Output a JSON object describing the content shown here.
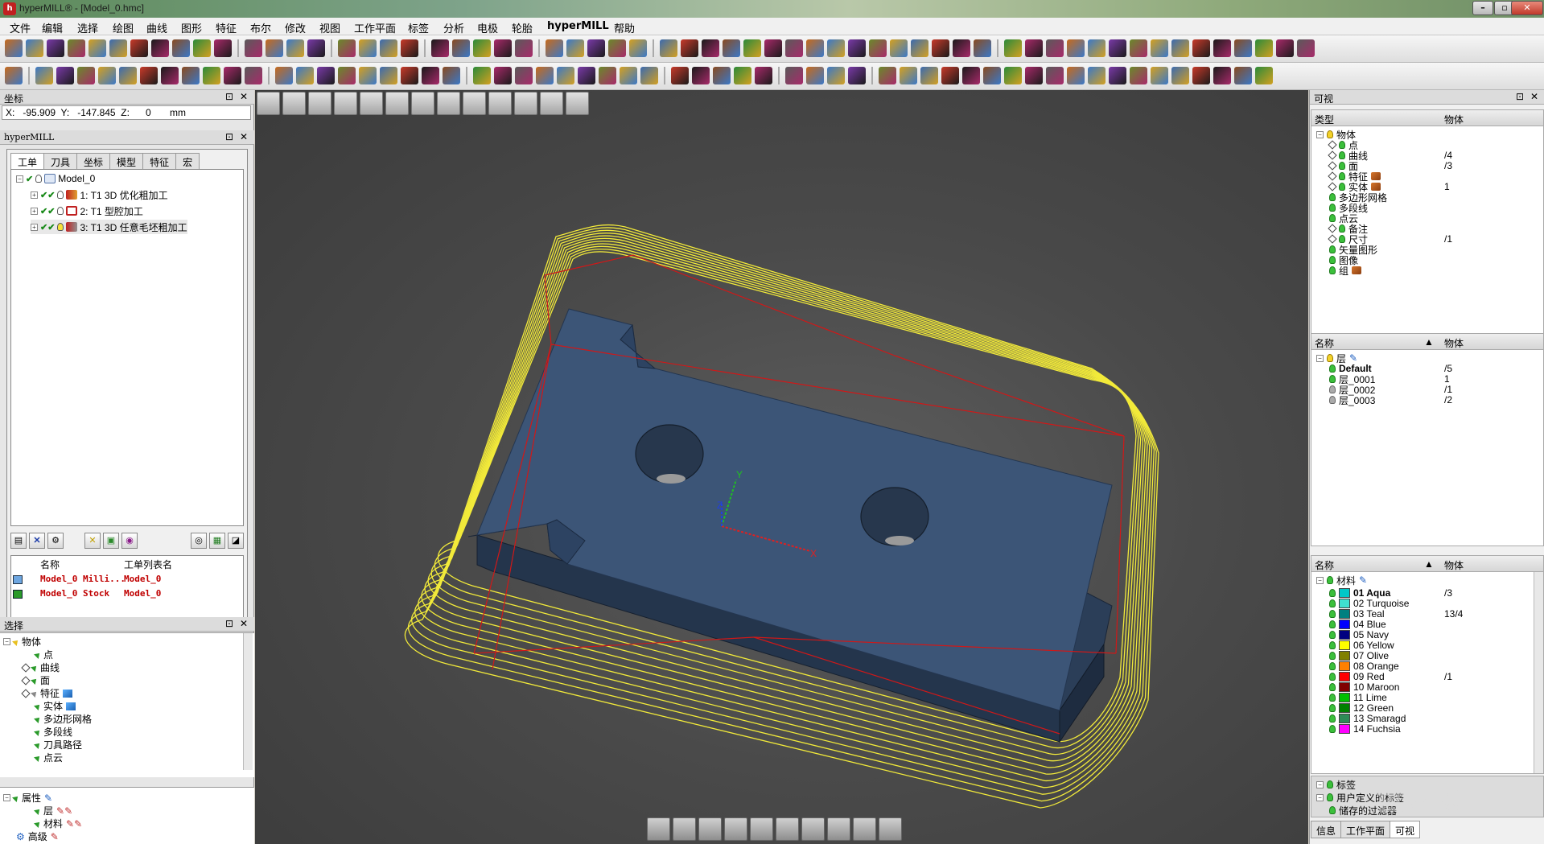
{
  "window": {
    "title": "hyperMILL® - [Model_0.hmc]",
    "app_icon": "h",
    "min_label": "–",
    "max_label": "▫",
    "close_label": "✕"
  },
  "menu": [
    "文件",
    "编辑",
    "选择",
    "绘图",
    "曲线",
    "图形",
    "特征",
    "布尔",
    "修改",
    "视图",
    "工作平面",
    "标签",
    "分析",
    "电极",
    "轮胎",
    "hyperMILL",
    "帮助"
  ],
  "left": {
    "coord_panel_title": "坐标",
    "coord_readout": {
      "x_label": "X:",
      "x": "-95.909",
      "y_label": "Y:",
      "y": "-147.845",
      "z_label": "Z:",
      "z": "0",
      "unit": "mm"
    },
    "hypermill_panel_title": "hyperMILL",
    "tabs": [
      "工单",
      "刀具",
      "坐标",
      "模型",
      "特征",
      "宏"
    ],
    "tree": {
      "root": "Model_0",
      "jobs": [
        "1: T1 3D 优化粗加工",
        "2: T1 型腔加工",
        "3: T1 3D 任意毛坯粗加工"
      ]
    },
    "ref_table": {
      "headers": [
        "名称",
        "工单列表名"
      ],
      "rows": [
        {
          "name": "Model_0 Milli...",
          "list": "Model_0"
        },
        {
          "name": "Model_0 Stock",
          "list": "Model_0"
        }
      ]
    },
    "select_panel_title": "选择",
    "select_tree": [
      "物体",
      "点",
      "曲线",
      "面",
      "特征",
      "实体",
      "多边形网格",
      "多段线",
      "刀具路径",
      "点云"
    ],
    "attr_tree": [
      "属性",
      "层",
      "材料",
      "高级"
    ]
  },
  "right": {
    "panel_title": "可视",
    "objects_header": {
      "type": "类型",
      "count": "物体"
    },
    "objects": [
      {
        "label": "物体",
        "count": ""
      },
      {
        "label": "点",
        "count": ""
      },
      {
        "label": "曲线",
        "count": "/4"
      },
      {
        "label": "面",
        "count": "/3"
      },
      {
        "label": "特征",
        "count": ""
      },
      {
        "label": "实体",
        "count": "1"
      },
      {
        "label": "多边形网格",
        "count": ""
      },
      {
        "label": "多段线",
        "count": ""
      },
      {
        "label": "点云",
        "count": ""
      },
      {
        "label": "备注",
        "count": ""
      },
      {
        "label": "尺寸",
        "count": "/1"
      },
      {
        "label": "矢量图形",
        "count": ""
      },
      {
        "label": "图像",
        "count": ""
      },
      {
        "label": "组",
        "count": ""
      }
    ],
    "layers_header": {
      "name": "名称",
      "count": "物体"
    },
    "layers": [
      {
        "label": "层",
        "count": ""
      },
      {
        "label": "Default",
        "count": "/5"
      },
      {
        "label": "层_0001",
        "count": "1"
      },
      {
        "label": "层_0002",
        "count": "/1"
      },
      {
        "label": "层_0003",
        "count": "/2"
      }
    ],
    "materials_header": {
      "name": "名称",
      "count": "物体"
    },
    "materials_root": "材料",
    "materials": [
      {
        "label": "01 Aqua",
        "count": "/3",
        "color": "#00c8c8"
      },
      {
        "label": "02 Turquoise",
        "count": "",
        "color": "#40e0d0"
      },
      {
        "label": "03 Teal",
        "count": "13/4",
        "color": "#008080"
      },
      {
        "label": "04 Blue",
        "count": "",
        "color": "#0000ff"
      },
      {
        "label": "05 Navy",
        "count": "",
        "color": "#000080"
      },
      {
        "label": "06 Yellow",
        "count": "",
        "color": "#ffff00"
      },
      {
        "label": "07 Olive",
        "count": "",
        "color": "#808000"
      },
      {
        "label": "08 Orange",
        "count": "",
        "color": "#ff8000"
      },
      {
        "label": "09 Red",
        "count": "/1",
        "color": "#ff0000"
      },
      {
        "label": "10 Maroon",
        "count": "",
        "color": "#800000"
      },
      {
        "label": "11 Lime",
        "count": "",
        "color": "#00c000"
      },
      {
        "label": "12 Green",
        "count": "",
        "color": "#008000"
      },
      {
        "label": "13 Smaragd",
        "count": "",
        "color": "#2e8b57"
      },
      {
        "label": "14 Fuchsia",
        "count": "",
        "color": "#ff00ff"
      }
    ],
    "extra_nodes": [
      "标签",
      "用户定义的标签",
      "储存的过滤器"
    ],
    "bottom_tabs": [
      "信息",
      "工作平面",
      "可视"
    ]
  },
  "watermark": "世界网",
  "colors": {
    "toolpath": "#f2ea3a",
    "stock_outline": "#d01818",
    "part_top": "#3c5577",
    "part_side": "#2b3e58",
    "accent_green": "#3bbf3b"
  }
}
